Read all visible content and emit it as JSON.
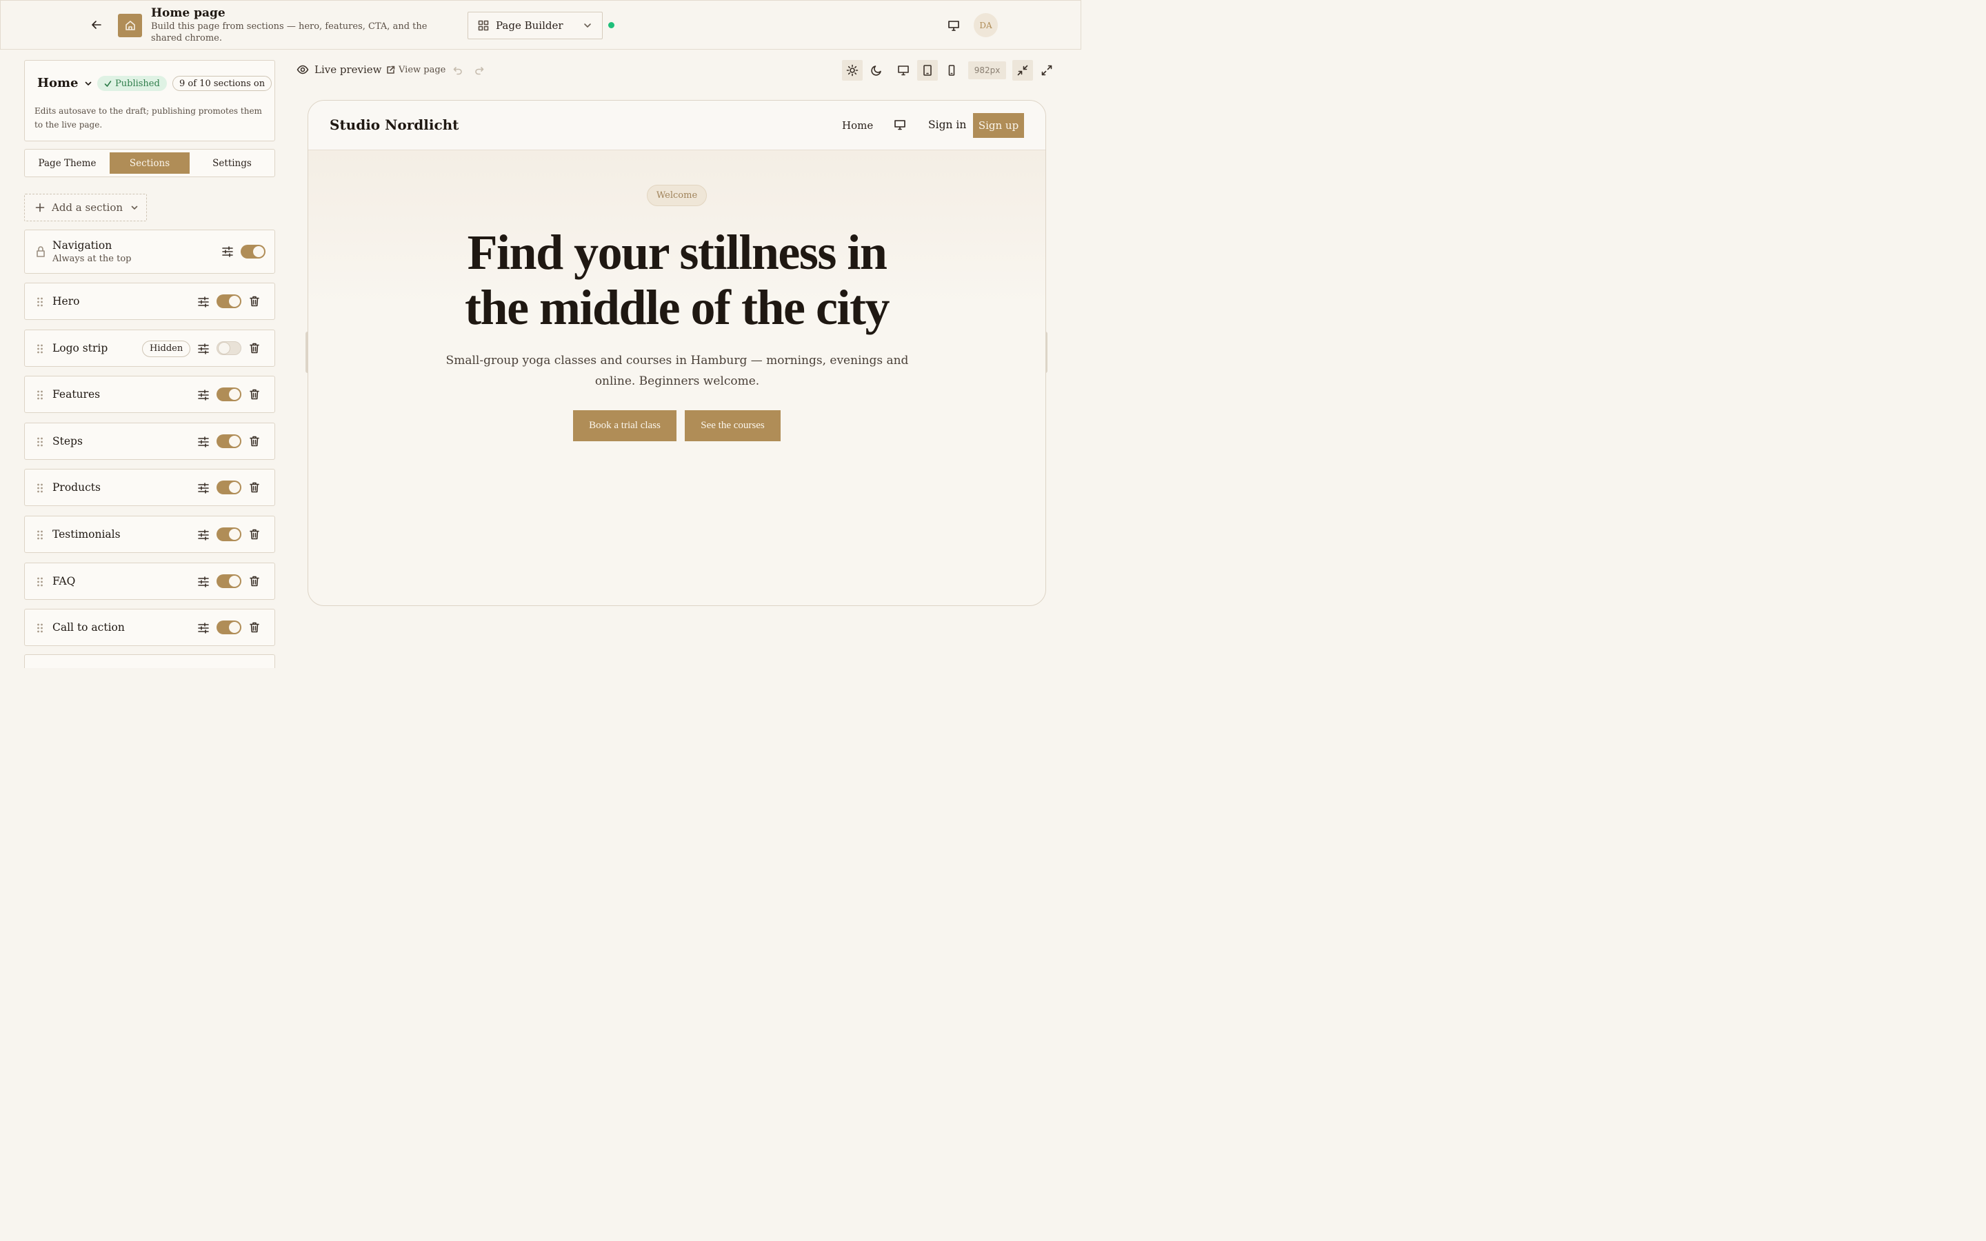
{
  "topbar": {
    "title": "Home page",
    "subtitle": "Build this page from sections — hero, features, CTA, and the shared chrome.",
    "builder_label": "Page Builder",
    "avatar_initials": "DA",
    "status_color": "#1fbf7a"
  },
  "panel": {
    "page_name": "Home",
    "published_label": "Published",
    "sections_count": "9 of 10 sections on",
    "autosave_note": "Edits autosave to the draft; publishing promotes them to the live page.",
    "tabs": [
      {
        "label": "Page Theme",
        "active": false
      },
      {
        "label": "Sections",
        "active": true
      },
      {
        "label": "Settings",
        "active": false
      }
    ],
    "add_section_label": "Add a section",
    "navigation": {
      "label": "Navigation",
      "sub": "Always at the top",
      "enabled": true
    },
    "sections": [
      {
        "label": "Hero",
        "enabled": true,
        "hidden_label": ""
      },
      {
        "label": "Logo strip",
        "enabled": false,
        "hidden_label": "Hidden"
      },
      {
        "label": "Features",
        "enabled": true,
        "hidden_label": ""
      },
      {
        "label": "Steps",
        "enabled": true,
        "hidden_label": ""
      },
      {
        "label": "Products",
        "enabled": true,
        "hidden_label": ""
      },
      {
        "label": "Testimonials",
        "enabled": true,
        "hidden_label": ""
      },
      {
        "label": "FAQ",
        "enabled": true,
        "hidden_label": ""
      },
      {
        "label": "Call to action",
        "enabled": true,
        "hidden_label": ""
      }
    ]
  },
  "preview_toolbar": {
    "live_label": "Live preview",
    "view_page_label": "View page",
    "width_label": "982px"
  },
  "site": {
    "brand": "Studio Nordlicht",
    "nav_home": "Home",
    "nav_signin": "Sign in",
    "nav_signup": "Sign up",
    "welcome": "Welcome",
    "hero_line1": "Find your stillness in",
    "hero_line2": "the middle of the city",
    "hero_sub": "Small-group yoga classes and courses in Hamburg — mornings, evenings and online. Beginners welcome.",
    "cta_primary": "Book a trial class",
    "cta_secondary": "See the courses"
  },
  "colors": {
    "accent": "#b08d57",
    "background": "#f8f5ef",
    "published_bg": "#dff2e4",
    "published_text": "#2f7d4a"
  }
}
